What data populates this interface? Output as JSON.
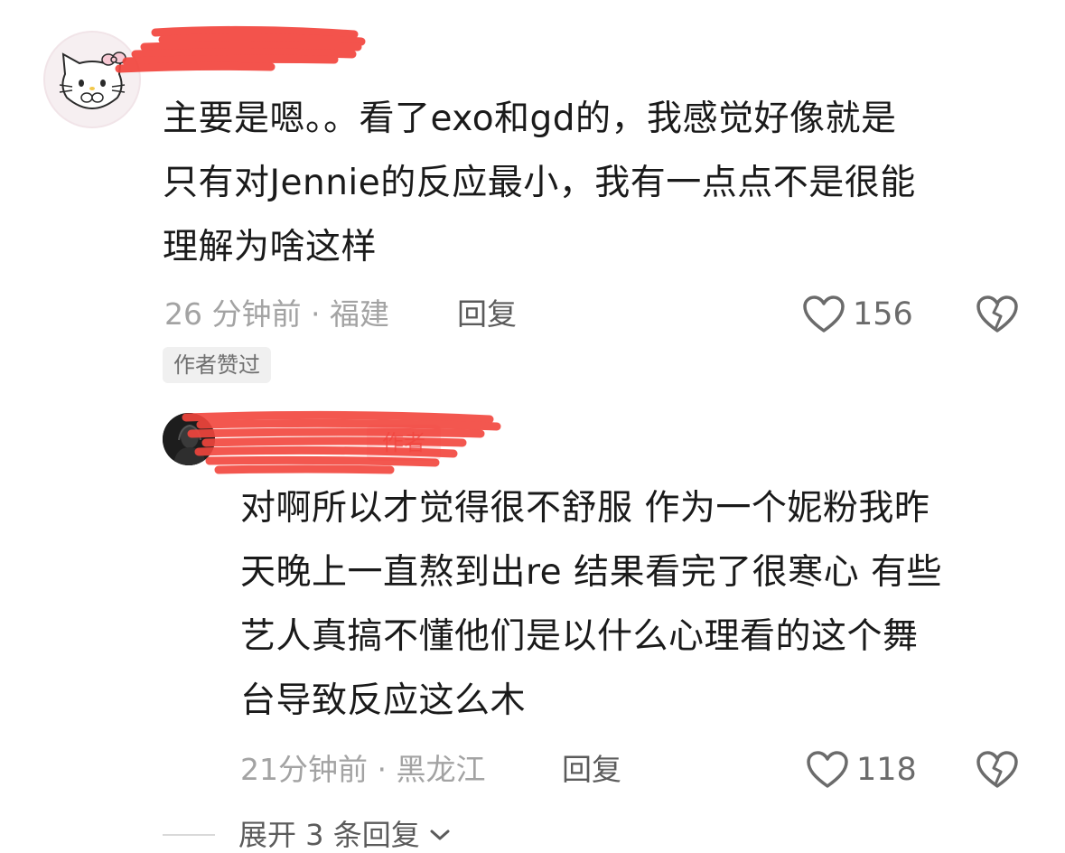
{
  "comment": {
    "author_avatar_icon": "hello-kitty-avatar-icon",
    "text": "主要是嗯。。看了exo和gd的，我感觉好像就是\n只有对Jennie的反应最小，我有一点点不是很能\n理解为啥这样",
    "meta": "26 分钟前 · 福建",
    "reply_label": "回复",
    "like_count": "156",
    "like_icon": "heart-outline-icon",
    "dislike_icon": "broken-heart-icon",
    "author_liked_badge": "作者赞过"
  },
  "reply": {
    "author_avatar_icon": "dark-avatar-icon",
    "author_tag": "作者",
    "text": "对啊所以才觉得很不舒服 作为一个妮粉我昨\n天晚上一直熬到出re 结果看完了很寒心 有些\n艺人真搞不懂他们是以什么心理看的这个舞\n台导致反应这么木",
    "meta": "21分钟前 · 黑龙江",
    "reply_label": "回复",
    "like_count": "118",
    "like_icon": "heart-outline-icon",
    "dislike_icon": "broken-heart-icon"
  },
  "expand": {
    "label": "展开 3 条回复",
    "icon": "chevron-down-icon"
  },
  "colors": {
    "redaction": "#f2453d",
    "meta_text": "#a3a3a3",
    "author_tag_bg": "#fde3e3",
    "author_tag_text": "#f06a6a"
  }
}
